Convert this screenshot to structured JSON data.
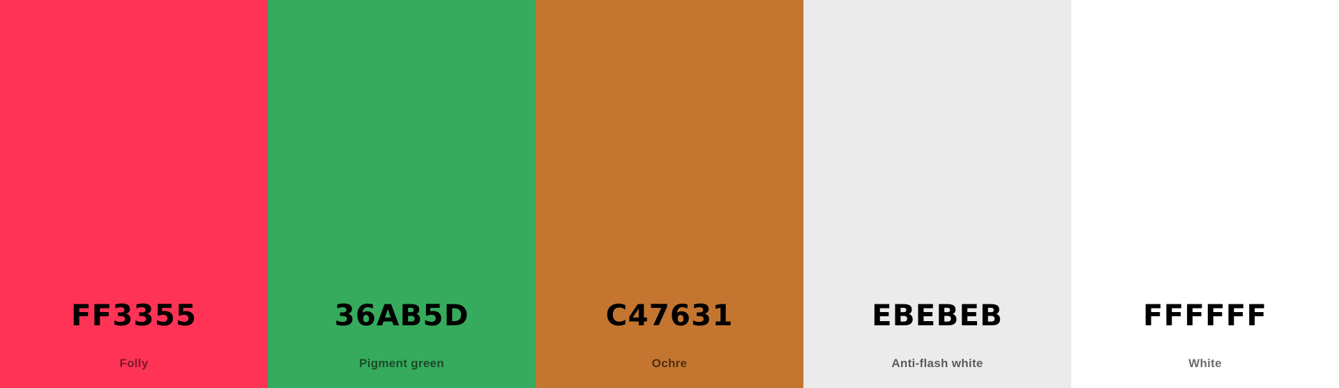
{
  "palette": {
    "swatches": [
      {
        "hex": "FF3355",
        "name": "Folly",
        "color": "#FF3355",
        "name_color": "#7a1a2a"
      },
      {
        "hex": "36AB5D",
        "name": "Pigment green",
        "color": "#36AB5D",
        "name_color": "#1c4a2a"
      },
      {
        "hex": "C47631",
        "name": "Ochre",
        "color": "#C47631",
        "name_color": "#4e2e12"
      },
      {
        "hex": "EBEBEB",
        "name": "Anti-flash white",
        "color": "#EBEBEB",
        "name_color": "#5c5c5c"
      },
      {
        "hex": "FFFFFF",
        "name": "White",
        "color": "#FFFFFF",
        "name_color": "#6b6b6b"
      }
    ]
  }
}
